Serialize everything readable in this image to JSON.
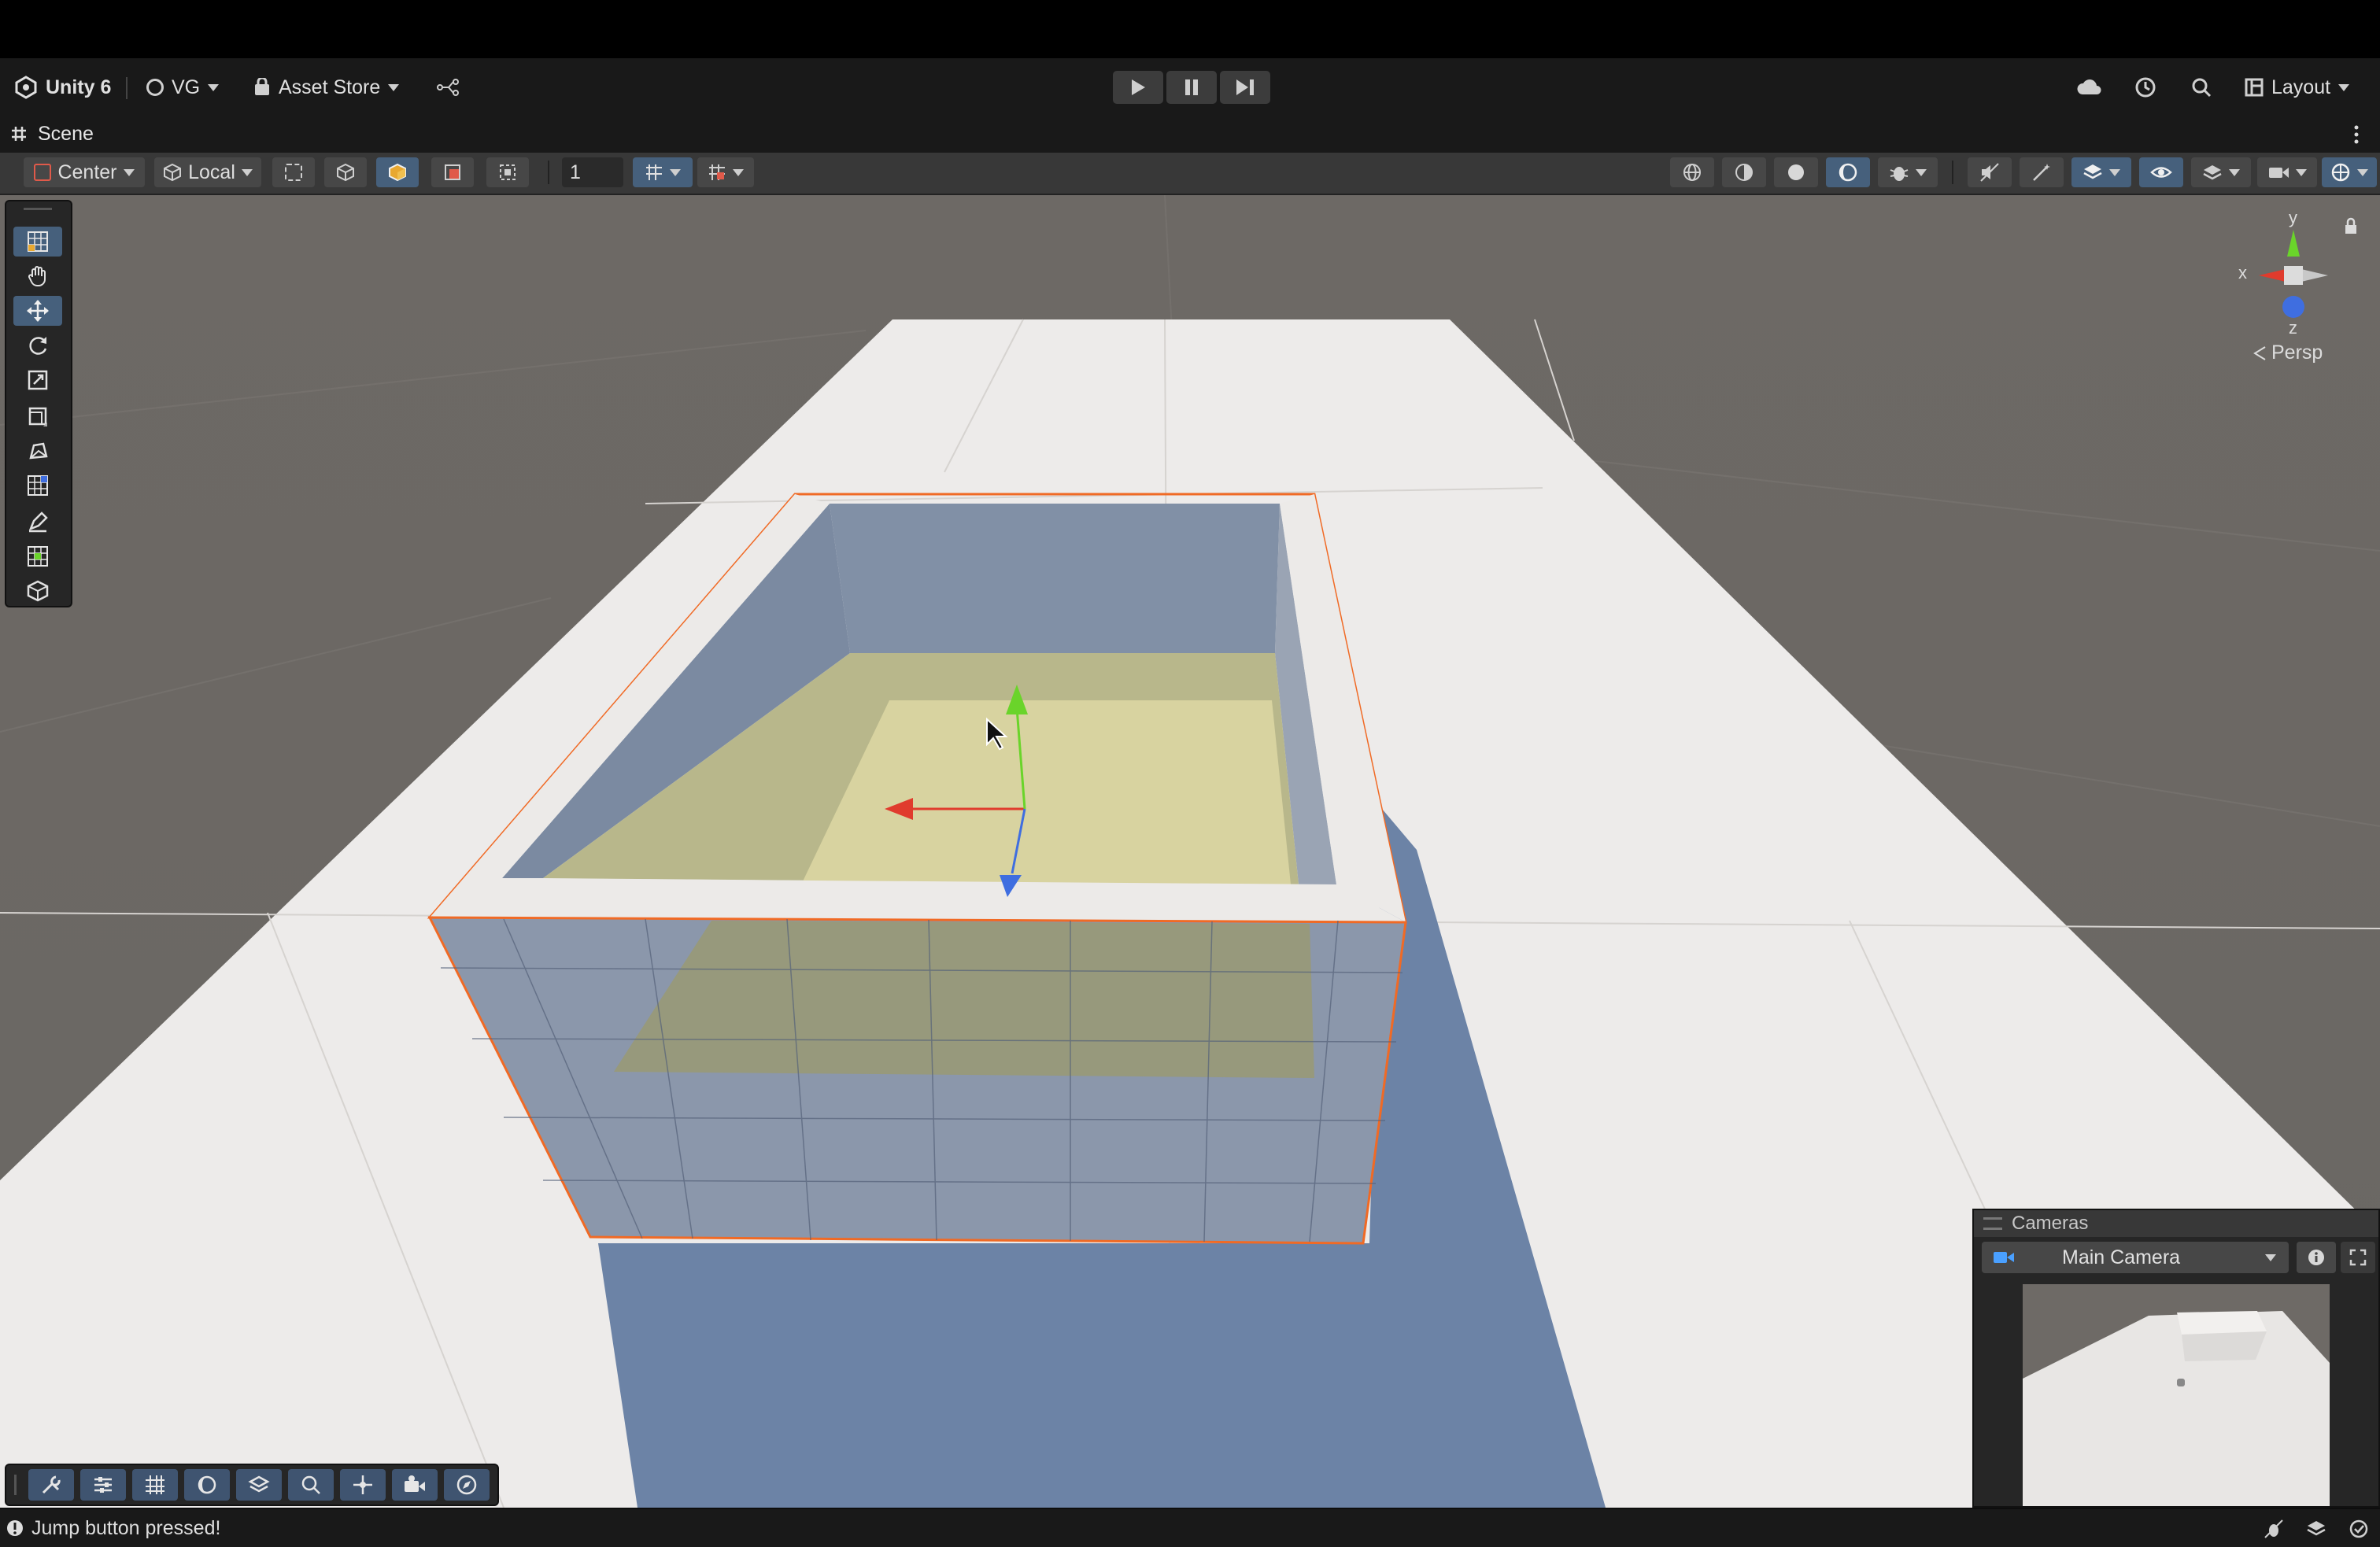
{
  "toolbar": {
    "product": "Unity 6",
    "account": "VG",
    "asset_store": "Asset Store",
    "layout": "Layout"
  },
  "tab": {
    "scene_label": "Scene"
  },
  "scene_toolbar": {
    "pivot_mode": "Center",
    "pivot_rotation": "Local",
    "grid_increment": "1"
  },
  "orientation_gizmo": {
    "axis_y": "y",
    "axis_x": "x",
    "axis_z": "z",
    "projection": "Persp"
  },
  "cameras": {
    "title": "Cameras",
    "selected": "Main Camera"
  },
  "status": {
    "message": "Jump button pressed!"
  },
  "colors": {
    "x_axis": "#e03b2d",
    "y_axis": "#6ad42a",
    "z_axis": "#3f6ee0",
    "selection_outline": "#f06a25",
    "accent": "#46607c"
  },
  "icons": [
    "unity-logo-icon",
    "account-icon",
    "asset-store-icon",
    "version-control-icon",
    "play-icon",
    "pause-icon",
    "step-icon",
    "cloud-icon",
    "history-icon",
    "search-icon",
    "layout-icon",
    "kebab-menu-icon"
  ]
}
